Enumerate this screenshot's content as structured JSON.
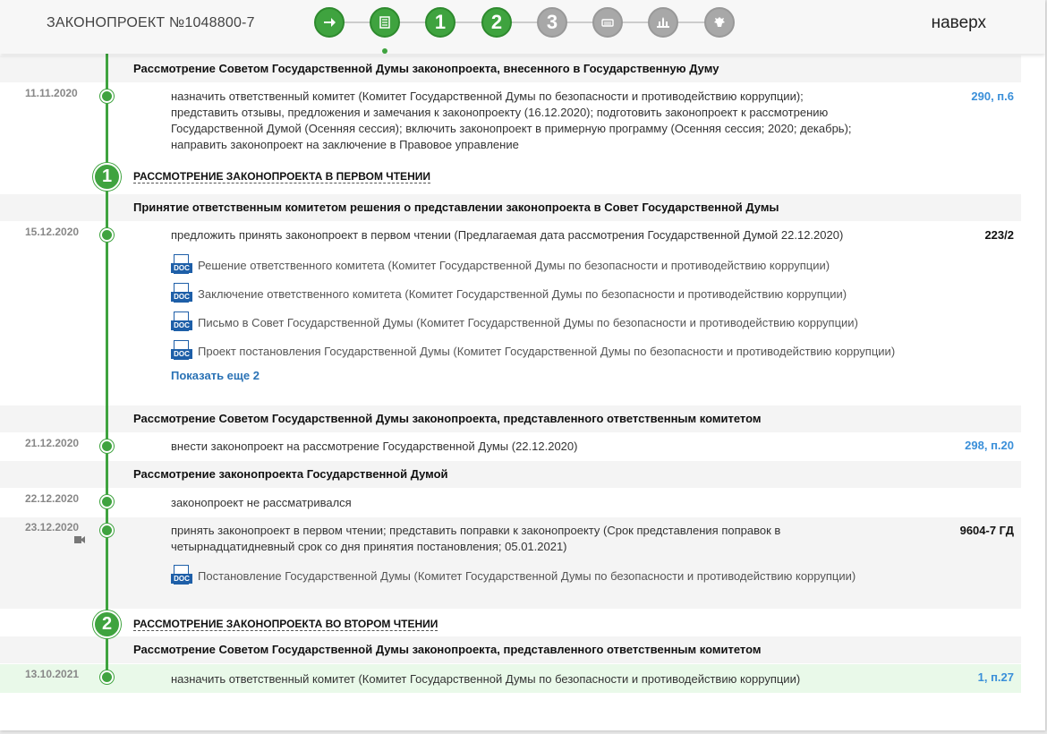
{
  "header": {
    "bill_title": "ЗАКОНОПРОЕКТ №1048800-7",
    "nav_top": "наверх",
    "stages": [
      {
        "label": "",
        "icon": "arrow-right-icon",
        "state": "done"
      },
      {
        "label": "",
        "icon": "document-list-icon",
        "state": "done"
      },
      {
        "label": "1",
        "icon": "",
        "state": "done"
      },
      {
        "label": "2",
        "icon": "",
        "state": "done"
      },
      {
        "label": "3",
        "icon": "",
        "state": "todo"
      },
      {
        "label": "",
        "icon": "council-icon",
        "state": "todo"
      },
      {
        "label": "",
        "icon": "building-icon",
        "state": "todo"
      },
      {
        "label": "",
        "icon": "emblem-icon",
        "state": "todo"
      }
    ]
  },
  "sections": {
    "s1": "Рассмотрение Советом Государственной Думы законопроекта, внесенного в Государственную Думу",
    "s2": "Принятие ответственным комитетом решения о представлении законопроекта в Совет Государственной Думы",
    "s3": "Рассмотрение Советом Государственной Думы законопроекта, представленного ответственным комитетом",
    "s4": "Рассмотрение законопроекта Государственной Думой",
    "s5": "Рассмотрение Советом Государственной Думы законопроекта, представленного ответственным комитетом"
  },
  "stage_titles": {
    "first_num": "1",
    "first": "РАССМОТРЕНИЕ ЗАКОНОПРОЕКТА В ПЕРВОМ ЧТЕНИИ",
    "second_num": "2",
    "second": "РАССМОТРЕНИЕ ЗАКОНОПРОЕКТА ВО ВТОРОМ ЧТЕНИИ"
  },
  "events": {
    "e1": {
      "date": "11.11.2020",
      "lines": [
        "назначить ответственный комитет (Комитет Государственной Думы по безопасности и противодействию коррупции);",
        "представить отзывы, предложения и замечания к законопроекту (16.12.2020); подготовить законопроект к рассмотрению",
        "Государственной Думой (Осенняя сессия); включить законопроект в примерную программу (Осенняя сессия; 2020; декабрь);",
        "направить законопроект на заключение в Правовое управление"
      ],
      "ref": "290, п.6"
    },
    "e2": {
      "date": "15.12.2020",
      "text": "предложить принять законопроект в первом чтении (Предлагаемая дата рассмотрения Государственной Думой 22.12.2020)",
      "ref": "223/2",
      "docs": [
        "Решение ответственного комитета (Комитет Государственной Думы по безопасности и противодействию коррупции)",
        "Заключение ответственного комитета (Комитет Государственной Думы по безопасности и противодействию коррупции)",
        "Письмо в Совет Государственной Думы (Комитет Государственной Думы по безопасности и противодействию коррупции)",
        "Проект постановления Государственной Думы (Комитет Государственной Думы по безопасности и противодействию коррупции)"
      ],
      "more": "Показать еще 2"
    },
    "e3": {
      "date": "21.12.2020",
      "text": "внести законопроект на рассмотрение Государственной Думы (22.12.2020)",
      "ref": "298, п.20"
    },
    "e4": {
      "date": "22.12.2020",
      "text": "законопроект не рассматривался"
    },
    "e5": {
      "date": "23.12.2020",
      "lines": [
        "принять законопроект в первом чтении; представить поправки к законопроекту (Срок представления поправок в",
        "четырнадцатидневный срок со дня принятия постановления; 05.01.2021)"
      ],
      "ref": "9604-7 ГД",
      "docs": [
        "Постановление Государственной Думы (Комитет Государственной Думы по безопасности и противодействию коррупции)"
      ]
    },
    "e6": {
      "date": "13.10.2021",
      "text": "назначить ответственный комитет (Комитет Государственной Думы по безопасности и противодействию коррупции)",
      "ref": "1, п.27"
    }
  },
  "doc_icon_label": "DOC",
  "colors": {
    "accent_green": "#3fa33f",
    "stage_grey": "#a8a8a8",
    "link_blue": "#3a8fd9",
    "doc_blue": "#1e5fa8",
    "highlight_row": "#e9f9e9"
  }
}
